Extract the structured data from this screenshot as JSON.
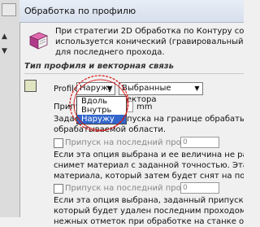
{
  "title": "Обработка по профилю",
  "info_lines": [
    "При стратегии 2D Обработка по Контуру создается",
    "используется конический (гравировальный) инстру",
    "для последнего прохода."
  ],
  "section_title": "Тип профиля и векторная связь",
  "profile_label": "Profile",
  "profile_value": "Наружу",
  "vectors_value": "Выбранные вектора",
  "dropdown_options": [
    "Вдоль",
    "Внутрь",
    "Наружу"
  ],
  "allowance_label": "Припус",
  "allowance_unit": "mm",
  "text_block1": [
    "Задает",
    "обрабатываемой области."
  ],
  "text_block1_tail": "ипуска на границе обрабатывае",
  "last_pass_label1": "Припуск на последний проход",
  "last_pass_value1": "0",
  "text_block2": [
    "Если эта опция выбрана и ее величина не равна нул",
    "снимет материал с заданной точностью. Эта опция ч",
    "материала, который затем будет снят на последнем"
  ],
  "last_pass_label2": "Припуск на последний проход",
  "last_pass_value2": "0",
  "text_block3": [
    "Если эта опция выбрана, заданный припуск оставлен",
    "который будет удален последним проходом. Эта опция",
    "нежных отметок при обработке на станке от приводо"
  ],
  "colors": {
    "accent": "#3366cc",
    "annotation": "#d81818"
  }
}
